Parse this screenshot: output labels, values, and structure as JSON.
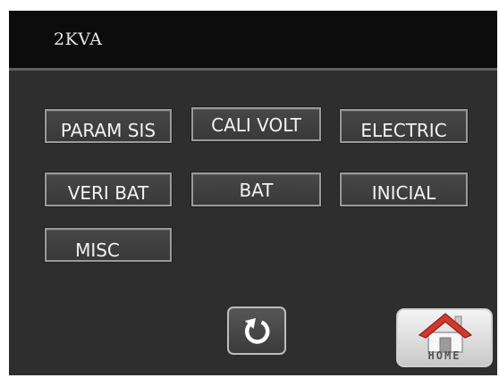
{
  "header": {
    "title": "2KVA"
  },
  "menu": {
    "param_sis": "PARAM SIS",
    "cali_volt": "CALI VOLT",
    "electric": "ELECTRIC",
    "veri_bat": "VERI BAT",
    "bat": "BAT",
    "inicial": "INICIAL",
    "misc": "MISC"
  },
  "footer": {
    "back_icon": "refresh-icon",
    "home_icon": "house-icon",
    "home_label": "HOME"
  },
  "colors": {
    "background": "#2e2e2e",
    "title_bar": "#0c0c0c",
    "button_border": "#9a9a9a",
    "home_roof": "#d4372c"
  }
}
